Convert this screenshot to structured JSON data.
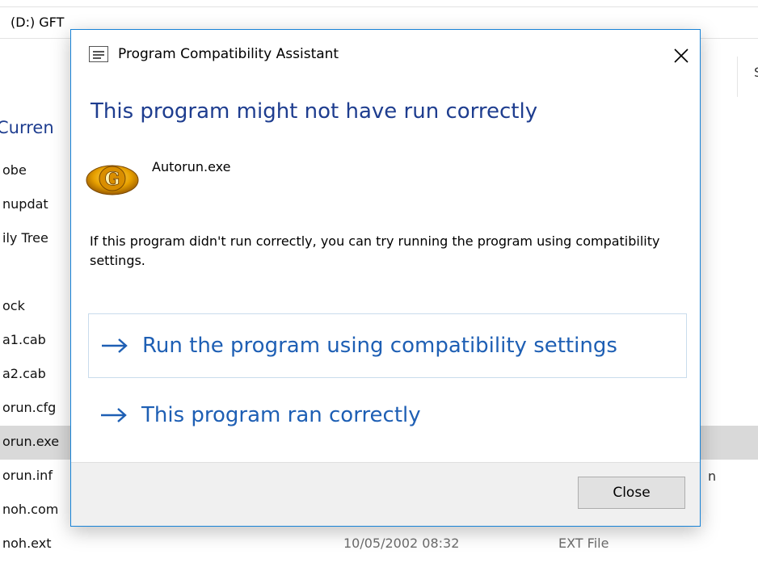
{
  "explorer": {
    "path": "(D:) GFT",
    "column_header_partial": "S",
    "section_heading_partial": "Curren",
    "files": [
      {
        "name": "obe",
        "date": "",
        "type": ""
      },
      {
        "name": "nupdat",
        "date": "",
        "type": ""
      },
      {
        "name": "ily Tree",
        "date": "",
        "type": ""
      },
      {
        "name": "",
        "date": "",
        "type": ""
      },
      {
        "name": "ock",
        "date": "",
        "type": ""
      },
      {
        "name": "a1.cab",
        "date": "",
        "type": ""
      },
      {
        "name": "a2.cab",
        "date": "",
        "type": ""
      },
      {
        "name": "orun.cfg",
        "date": "",
        "type": ""
      },
      {
        "name": "orun.exe",
        "date": "",
        "type": "",
        "selected": true
      },
      {
        "name": "orun.inf",
        "date": "",
        "type": ""
      },
      {
        "name": "noh.com",
        "date": "",
        "type": ""
      },
      {
        "name": "noh.ext",
        "date": "10/05/2002 08:32",
        "type": "EXT File"
      }
    ],
    "trailing_text": "n"
  },
  "dialog": {
    "title": "Program Compatibility Assistant",
    "title_icon": "application-window-icon",
    "main_instruction": "This program might not have run correctly",
    "program_icon": "gft-gold-g-icon",
    "program_name": "Autorun.exe",
    "description": "If this program didn't run correctly, you can try running the program using compatibility settings.",
    "commands": [
      {
        "label": "Run the program using compatibility settings",
        "icon": "arrow-right-icon",
        "focused": true
      },
      {
        "label": "This program ran correctly",
        "icon": "arrow-right-icon",
        "focused": false
      }
    ],
    "close_button_label": "Close"
  },
  "colors": {
    "accent_border": "#1883d7",
    "heading_text": "#1e3d8f",
    "link_text": "#1e5fb4",
    "footer_bg": "#f0f0f0",
    "selected_row": "#d9d9d9"
  }
}
